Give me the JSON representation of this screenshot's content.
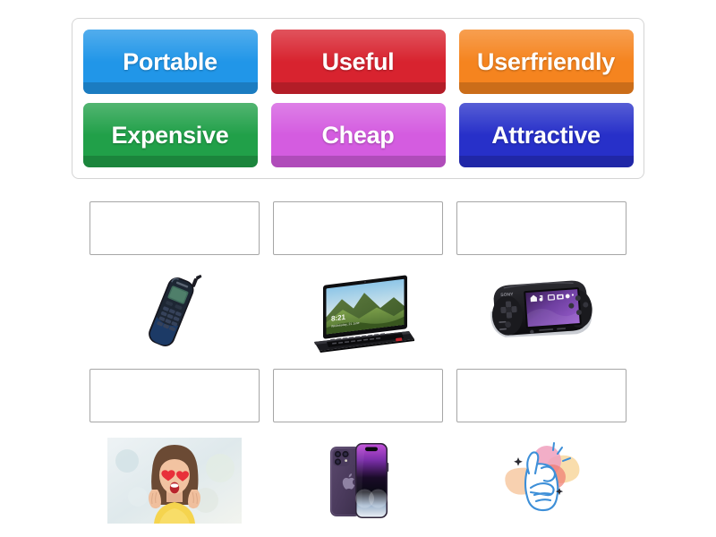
{
  "activity": {
    "type": "match-up drag and drop",
    "word_bank": {
      "rows": [
        [
          {
            "label": "Portable",
            "color": "#2196e8",
            "name": "tile-portable"
          },
          {
            "label": "Useful",
            "color": "#d8232f",
            "name": "tile-useful"
          },
          {
            "label": "Userfriendly",
            "color": "#f5841f",
            "name": "tile-userfriendly"
          }
        ],
        [
          {
            "label": "Expensive",
            "color": "#21a049",
            "name": "tile-expensive"
          },
          {
            "label": "Cheap",
            "color": "#d45ce0",
            "name": "tile-cheap"
          },
          {
            "label": "Attractive",
            "color": "#2730c9",
            "name": "tile-attractive"
          }
        ]
      ]
    },
    "board": {
      "dropzone_placeholder": "",
      "rows": [
        [
          {
            "image": "old-mobile-phone",
            "dropzone_label": ""
          },
          {
            "image": "laptop-computer",
            "dropzone_label": ""
          },
          {
            "image": "psp-handheld-console",
            "dropzone_label": ""
          }
        ],
        [
          {
            "image": "woman-with-heart-eyes",
            "dropzone_label": ""
          },
          {
            "image": "purple-smartphone",
            "dropzone_label": ""
          },
          {
            "image": "snapping-fingers-hand",
            "dropzone_label": ""
          }
        ]
      ]
    }
  },
  "colors": {
    "container_border": "#d4d4d4",
    "dropzone_border": "#a6a6a6",
    "background": "#ffffff",
    "tile_text": "#ffffff"
  }
}
